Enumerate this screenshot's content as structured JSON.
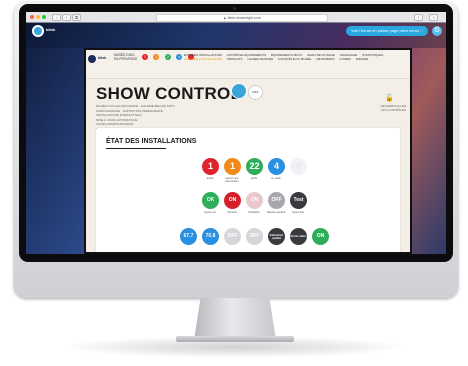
{
  "browser": {
    "url": "▲ blink.showmight.com",
    "buttons": [
      "‹",
      "›",
      "⧉"
    ]
  },
  "toolbar": {
    "app_name": "blink",
    "fullscreen_label": "Voir l'écran en pleine page plein écran ⛶",
    "gear_icon": "gear-icon"
  },
  "page": {
    "logo_text": "blink",
    "breadcrumb": "MUSÉE D'AIX-EN-PROVENCE",
    "dots": [
      {
        "label": "1",
        "color": "#e0242c"
      },
      {
        "label": "1",
        "color": "#f28a1a"
      },
      {
        "label": "2",
        "color": "#2fae5a"
      },
      {
        "label": "4",
        "color": "#2a8fe0"
      },
      {
        "label": "",
        "color": "#e0242c"
      }
    ],
    "menu": [
      {
        "label": "ÉTAT DES INSTALLATIONS",
        "highlight": false
      },
      {
        "label": "CONTRÔLE ÉQUIPEMENTS",
        "highlight": false
      },
      {
        "label": "ÉQUIPEMENTS MULTI",
        "highlight": false
      },
      {
        "label": "ANALYSE D'USAGE",
        "highlight": false
      },
      {
        "label": "ARCHIVAGE",
        "highlight": false
      },
      {
        "label": "STATISTIQUES",
        "highlight": false
      },
      {
        "label": "ALLUMER L'INSTALLATION",
        "highlight": true
      },
      {
        "label": "PRODUITS",
        "highlight": false
      },
      {
        "label": "CAHIER DE BORD",
        "highlight": false
      },
      {
        "label": "CONTRÔLE DU MUSÉE",
        "highlight": false
      },
      {
        "label": "MINISTÈRES",
        "highlight": false
      },
      {
        "label": "GUIDES",
        "highlight": false
      },
      {
        "label": "DIRIGER",
        "highlight": false
      }
    ],
    "title": "SHOW CONTROL",
    "title_badge_text": "blink",
    "subinfo": [
      "MUSÉE D'AIX-EN-PROVENCE · GALERIE BELLES ARTS",
      "SCÉNOGRAPHIE · EXPOSITION PERMANENTE",
      "INSTALLATIONS INTERACTIVES",
      "MISE À JOUR AUTOMATIQUE",
      "ACCÈS ADMINISTRATEUR",
      "DERNIÈRE SYNCHRO"
    ],
    "lock_text": "DÉVERROUILLER LES CONTRÔLES"
  },
  "panel": {
    "title": "ÉTAT DES INSTALLATIONS",
    "row1": [
      {
        "value": "1",
        "label": "arrêté",
        "color": "#e0242c"
      },
      {
        "value": "1",
        "label": "besoin une intervention",
        "color": "#f28a1a"
      },
      {
        "value": "22",
        "label": "actifs",
        "color": "#2fae5a"
      },
      {
        "value": "4",
        "label": "en veille",
        "color": "#2a8fe0"
      },
      {
        "value": "0",
        "label": "",
        "color": "#f2f2f6"
      }
    ],
    "row2": [
      {
        "value": "OK",
        "label": "Ajouré etc",
        "color": "#2fae5a"
      },
      {
        "value": "ON",
        "label": "Sécurité",
        "color": "#d4202a"
      },
      {
        "value": "ON",
        "label": "Ventilation",
        "color": "#e8c8cc"
      },
      {
        "value": "OFF",
        "label": "Réseau général",
        "color": "#a8a8ac"
      },
      {
        "value": "Test",
        "label": "Accès test",
        "color": "#3a3a3e"
      }
    ],
    "row3": [
      {
        "value": "67.7",
        "color": "#2a8fe0"
      },
      {
        "value": "70.8",
        "color": "#2a8fe0"
      },
      {
        "value": "OFF",
        "color": "#d6d6da"
      },
      {
        "value": "OFF",
        "color": "#d6d6da"
      },
      {
        "value": "Extinction qualité",
        "color": "#3a3a3e"
      },
      {
        "value": "Ecran vidéo",
        "color": "#3a3a3e"
      },
      {
        "value": "ON",
        "color": "#2fae5a"
      }
    ]
  }
}
